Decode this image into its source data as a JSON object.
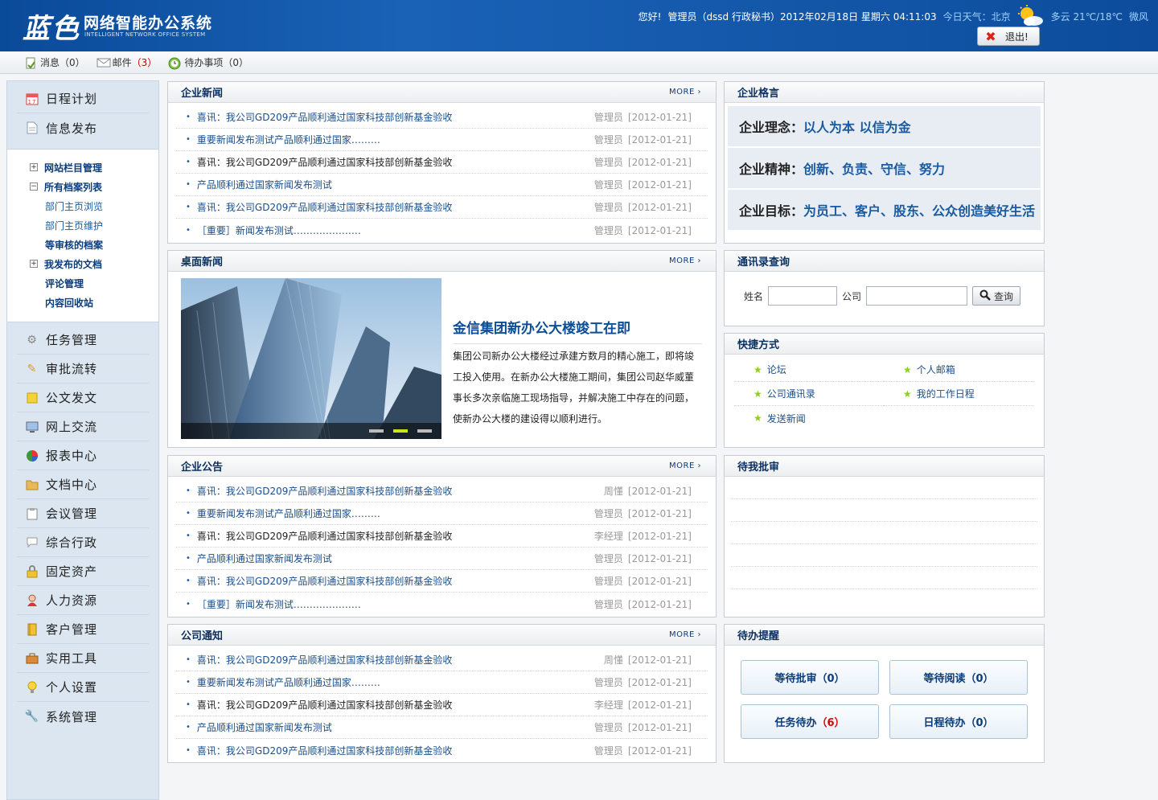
{
  "header": {
    "logo_main": "蓝色",
    "logo_cn": "网络智能办公系统",
    "logo_en": "INTELLIGENT NETWORK OFFICE SYSTEM",
    "greeting": "您好!",
    "user": "管理员（dssd 行政秘书）",
    "datetime": "2012年02月18日 星期六 04:11:03",
    "weather_label": "今日天气：北京",
    "weather": "多云 21℃/18℃",
    "wind": "微风",
    "logout": "退出!"
  },
  "toolbar": {
    "messages_label": "消息",
    "messages_count": "（0）",
    "mail_label": "邮件",
    "mail_count": "（3）",
    "todo_label": "待办事项",
    "todo_count": "（0）"
  },
  "sidebar": {
    "top_items": [
      "日程计划",
      "信息发布"
    ],
    "submenu": [
      {
        "label": "网站栏目管理",
        "toggle": "+"
      },
      {
        "label": "所有档案列表",
        "toggle": "-"
      },
      {
        "label": "部门主页浏览"
      },
      {
        "label": "部门主页维护"
      },
      {
        "label": "等审核的档案"
      },
      {
        "label": "我发布的文档",
        "toggle": "+"
      },
      {
        "label": "评论管理"
      },
      {
        "label": "内容回收站"
      }
    ],
    "items": [
      "任务管理",
      "审批流转",
      "公文发文",
      "网上交流",
      "报表中心",
      "文档中心",
      "会议管理",
      "综合行政",
      "固定资产",
      "人力资源",
      "客户管理",
      "实用工具",
      "个人设置",
      "系统管理"
    ]
  },
  "more_label": "MORE ›",
  "company_news": {
    "title": "企业新闻",
    "rows": [
      {
        "text": "喜讯：我公司GD209产品顺利通过国家科技部创新基金验收",
        "author": "管理员",
        "date": "[2012-01-21]"
      },
      {
        "text": "重要新闻发布测试产品顺利通过国家………",
        "author": "管理员",
        "date": "[2012-01-21]"
      },
      {
        "text": "喜讯：我公司GD209产品顺利通过国家科技部创新基金验收",
        "author": "管理员",
        "date": "[2012-01-21]"
      },
      {
        "text": "产品顺利通过国家新闻发布测试",
        "author": "管理员",
        "date": "[2012-01-21]"
      },
      {
        "text": "喜讯：我公司GD209产品顺利通过国家科技部创新基金验收",
        "author": "管理员",
        "date": "[2012-01-21]"
      },
      {
        "text": "［重要］新闻发布测试…………………",
        "author": "管理员",
        "date": "[2012-01-21]"
      }
    ]
  },
  "motto": {
    "title": "企业格言",
    "rows": [
      {
        "k": "企业理念：",
        "v": "以人为本 以信为金"
      },
      {
        "k": "企业精神：",
        "v": "创新、负责、守信、努力"
      },
      {
        "k": "企业目标：",
        "v": "为员工、客户、股东、公众创造美好生活"
      }
    ]
  },
  "desktop_news": {
    "title": "桌面新闻",
    "headline": "金信集团新办公大楼竣工在即",
    "body": "集团公司新办公大楼经过承建方数月的精心施工，即将竣工投入使用。在新办公大楼施工期间，集团公司赵华威董事长多次亲临施工现场指导，并解决施工中存在的问题，使新办公大楼的建设得以顺利进行。"
  },
  "contacts": {
    "title": "通讯录查询",
    "name_label": "姓名",
    "company_label": "公司",
    "search_button": "查询"
  },
  "shortcuts": {
    "title": "快捷方式",
    "items": [
      "论坛",
      "个人邮箱",
      "公司通讯录",
      "我的工作日程",
      "发送新闻"
    ]
  },
  "notices": {
    "title": "企业公告",
    "rows": [
      {
        "text": "喜讯：我公司GD209产品顺利通过国家科技部创新基金验收",
        "author": "周懂",
        "date": "[2012-01-21]"
      },
      {
        "text": "重要新闻发布测试产品顺利通过国家………",
        "author": "管理员",
        "date": "[2012-01-21]"
      },
      {
        "text": "喜讯：我公司GD209产品顺利通过国家科技部创新基金验收",
        "author": "李经理",
        "date": "[2012-01-21]"
      },
      {
        "text": "产品顺利通过国家新闻发布测试",
        "author": "管理员",
        "date": "[2012-01-21]"
      },
      {
        "text": "喜讯：我公司GD209产品顺利通过国家科技部创新基金验收",
        "author": "管理员",
        "date": "[2012-01-21]"
      },
      {
        "text": "［重要］新闻发布测试…………………",
        "author": "管理员",
        "date": "[2012-01-21]"
      }
    ]
  },
  "approvals": {
    "title": "待我批审"
  },
  "company_notices": {
    "title": "公司通知",
    "rows": [
      {
        "text": "喜讯：我公司GD209产品顺利通过国家科技部创新基金验收",
        "author": "周懂",
        "date": "[2012-01-21]"
      },
      {
        "text": "重要新闻发布测试产品顺利通过国家………",
        "author": "管理员",
        "date": "[2012-01-21]"
      },
      {
        "text": "喜讯：我公司GD209产品顺利通过国家科技部创新基金验收",
        "author": "李经理",
        "date": "[2012-01-21]"
      },
      {
        "text": "产品顺利通过国家新闻发布测试",
        "author": "管理员",
        "date": "[2012-01-21]"
      },
      {
        "text": "喜讯：我公司GD209产品顺利通过国家科技部创新基金验收",
        "author": "管理员",
        "date": "[2012-01-21]"
      }
    ]
  },
  "reminders": {
    "title": "待办提醒",
    "items": [
      {
        "label": "等待批审",
        "count": "（0）",
        "highlight": false
      },
      {
        "label": "等待阅读",
        "count": "（0）",
        "highlight": false
      },
      {
        "label": "任务待办",
        "count": "（6）",
        "highlight": true
      },
      {
        "label": "日程待办",
        "count": "（0）",
        "highlight": false
      }
    ]
  },
  "colors": {
    "header_blue": "#0d4c9c",
    "link_blue": "#1a4f8c",
    "accent_red": "#cc0000",
    "star_green": "#8ccf1c"
  }
}
